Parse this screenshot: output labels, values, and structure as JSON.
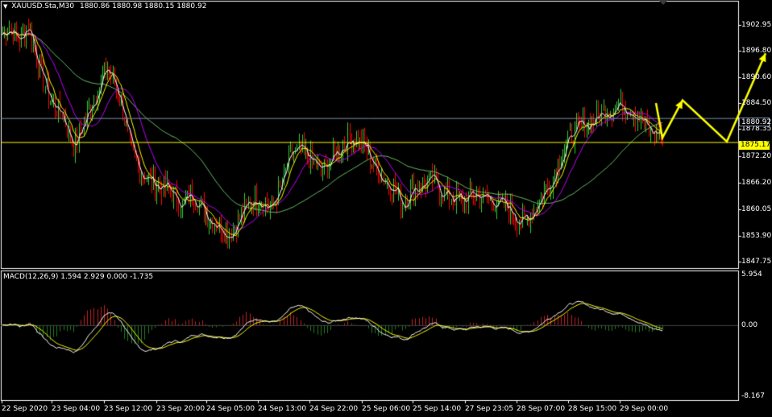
{
  "header": {
    "symbol": "XAUUSD.Sta,M30",
    "ohlc": "1880.86 1880.98 1880.15 1880.92"
  },
  "price_axis": {
    "ticks": [
      "1902.95",
      "1896.80",
      "1890.60",
      "1884.50",
      "1878.35",
      "1872.20",
      "1866.20",
      "1860.05",
      "1853.90",
      "1847.75"
    ],
    "current_price": "1880.92",
    "level_price": "1875.17"
  },
  "macd": {
    "label": "MACD(12,26,9) 1.594 2.929 0.000 -1.735",
    "ticks": [
      "5.954",
      "0.00",
      "-8.167"
    ]
  },
  "time_axis": {
    "labels": [
      "22 Sep 2020",
      "23 Sep 04:00",
      "23 Sep 12:00",
      "23 Sep 20:00",
      "24 Sep 05:00",
      "24 Sep 13:00",
      "24 Sep 22:00",
      "25 Sep 06:00",
      "25 Sep 14:00",
      "27 Sep 23:05",
      "28 Sep 07:00",
      "28 Sep 15:00",
      "29 Sep 00:00"
    ]
  },
  "colors": {
    "background": "#000000",
    "bull": "#32cd32",
    "bear": "#ff0000",
    "grid_border": "#ffffff",
    "ma_fast": "#ffffff",
    "ma_mid": "#ffff00",
    "ma_slow_purple": "#c000ff",
    "ma_long_green": "#6ac06a",
    "level_line": "#ffff00",
    "current_line": "#7a8ea8",
    "macd_line": "#ffffff",
    "signal_line": "#ffff00",
    "hist_pos": "#c02020",
    "hist_neg": "#1f7a1f",
    "projection": "#ffff00"
  },
  "chart_data": {
    "type": "candlestick",
    "title": "XAUUSD.Sta,M30",
    "ylim": [
      1845.0,
      1909.0
    ],
    "path": [
      [
        0,
        1901
      ],
      [
        4,
        1903
      ],
      [
        10,
        1899
      ],
      [
        15,
        1904
      ],
      [
        20,
        1895
      ],
      [
        28,
        1885
      ],
      [
        35,
        1882
      ],
      [
        42,
        1874
      ],
      [
        48,
        1880
      ],
      [
        56,
        1888
      ],
      [
        62,
        1893
      ],
      [
        70,
        1885
      ],
      [
        76,
        1872
      ],
      [
        82,
        1868
      ],
      [
        90,
        1865
      ],
      [
        98,
        1864
      ],
      [
        106,
        1860
      ],
      [
        112,
        1863
      ],
      [
        120,
        1858
      ],
      [
        126,
        1856
      ],
      [
        134,
        1853
      ],
      [
        140,
        1857
      ],
      [
        146,
        1861
      ],
      [
        152,
        1862
      ],
      [
        158,
        1859
      ],
      [
        164,
        1864
      ],
      [
        170,
        1872
      ],
      [
        176,
        1873
      ],
      [
        182,
        1871
      ],
      [
        188,
        1868
      ],
      [
        196,
        1872
      ],
      [
        202,
        1875
      ],
      [
        208,
        1876
      ],
      [
        214,
        1874
      ],
      [
        220,
        1869
      ],
      [
        226,
        1866
      ],
      [
        232,
        1864
      ],
      [
        236,
        1860
      ],
      [
        242,
        1864
      ],
      [
        248,
        1865
      ],
      [
        254,
        1866
      ],
      [
        260,
        1863
      ],
      [
        266,
        1862
      ],
      [
        272,
        1861
      ],
      [
        278,
        1863
      ],
      [
        284,
        1862
      ],
      [
        290,
        1861
      ],
      [
        296,
        1860
      ],
      [
        300,
        1859
      ],
      [
        304,
        1857
      ],
      [
        308,
        1856
      ],
      [
        312,
        1858
      ],
      [
        318,
        1862
      ],
      [
        324,
        1866
      ],
      [
        330,
        1872
      ],
      [
        336,
        1877
      ],
      [
        342,
        1879
      ],
      [
        348,
        1880
      ],
      [
        354,
        1882
      ],
      [
        358,
        1883
      ],
      [
        364,
        1884
      ],
      [
        368,
        1884
      ],
      [
        372,
        1883
      ],
      [
        376,
        1881
      ],
      [
        380,
        1879
      ],
      [
        383,
        1877
      ],
      [
        386,
        1878
      ],
      [
        390,
        1876
      ]
    ],
    "price_level": 1875.17,
    "current_price": 1880.92,
    "macd_range": [
      -8.167,
      5.954
    ]
  }
}
